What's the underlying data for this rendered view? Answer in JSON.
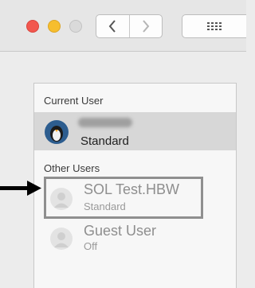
{
  "titlebar": {
    "traffic_lights": {
      "close_color": "#f2574e",
      "minimize_color": "#f6be2e",
      "zoom_color": "#dadada"
    },
    "back_icon": "chevron-left-icon",
    "forward_icon": "chevron-right-icon",
    "grid_icon": "grid-icon"
  },
  "users_panel": {
    "current_user_label": "Current User",
    "current_user": {
      "name": "",
      "status": "Standard"
    },
    "other_users_label": "Other Users",
    "other_users": [
      {
        "name": "SOL Test.HBW",
        "status": "Standard"
      },
      {
        "name": "Guest User",
        "status": "Off"
      }
    ]
  },
  "annotation": {
    "arrow_icon": "arrow-right-icon",
    "highlight_color": "#8f8f8f"
  }
}
